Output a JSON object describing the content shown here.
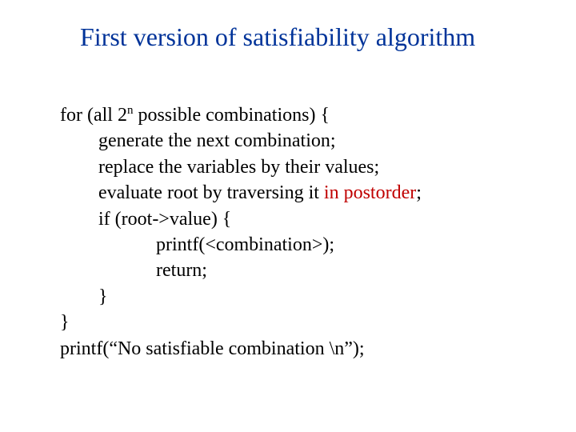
{
  "title": "First version of satisfiability algorithm",
  "code": {
    "line1_pre": "for (all 2",
    "line1_exp": "n",
    "line1_post": " possible combinations) {",
    "line2": "generate the next combination;",
    "line3": "replace the variables by their values;",
    "line4_a": "evaluate root by traversing it ",
    "line4_b": "in postorder",
    "line4_c": ";",
    "line5": "if (root->value) {",
    "line6": "printf(<combination>);",
    "line7": "return;",
    "line8": "}",
    "line9": "}",
    "line10": "printf(“No satisfiable combination \\n”);"
  }
}
